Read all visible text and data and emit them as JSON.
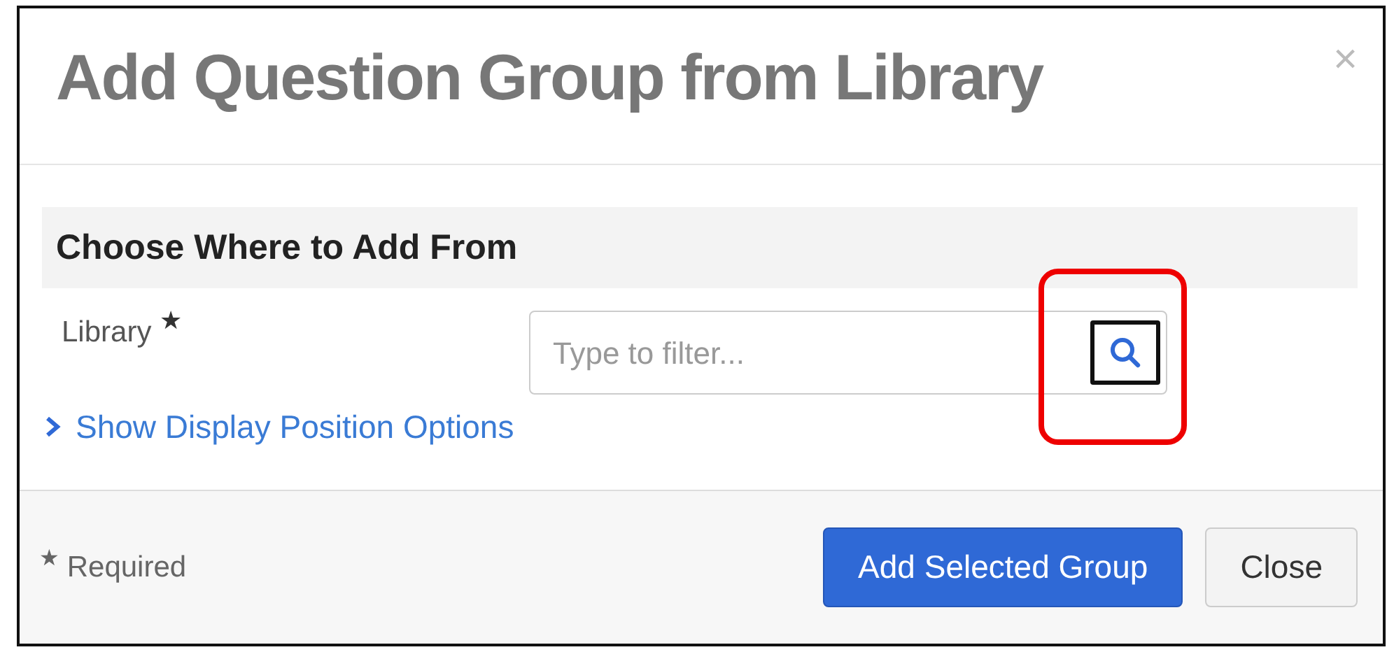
{
  "dialog": {
    "title": "Add Question Group from Library",
    "close": "×"
  },
  "section": {
    "heading": "Choose Where to Add From"
  },
  "field": {
    "label": "Library",
    "required_mark": "★",
    "placeholder": "Type to filter...",
    "search_focused": true,
    "highlighted": true
  },
  "link": {
    "label": "Show Display Position Options",
    "expanded": false
  },
  "footer": {
    "required_mark": "★",
    "required_note": "Required",
    "buttons": [
      {
        "label": "Add Selected Group",
        "kind": "primary"
      },
      {
        "label": "Close",
        "kind": "secondary"
      }
    ]
  }
}
